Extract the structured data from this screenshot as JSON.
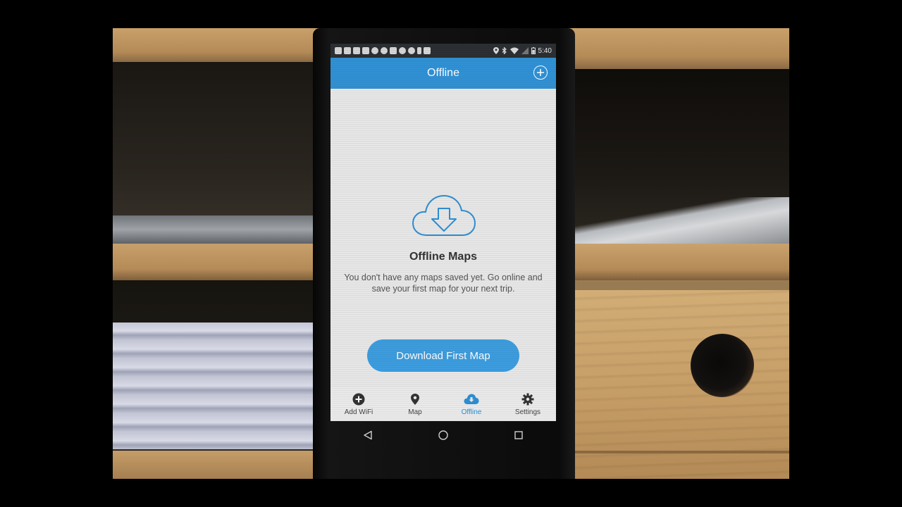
{
  "status_bar": {
    "time": "5:40",
    "icons": [
      "keyboard-icon",
      "facebook-icon",
      "facebook-icon",
      "facebook-icon",
      "globe-icon",
      "globe-icon",
      "facebook-icon",
      "globe-icon",
      "globe-icon",
      "android-icon",
      "mail-icon",
      "location-icon",
      "bluetooth-icon",
      "wifi-icon",
      "no-sim-icon",
      "battery-icon"
    ]
  },
  "app_bar": {
    "title": "Offline"
  },
  "empty_state": {
    "title": "Offline Maps",
    "description": "You don't have any maps saved yet. Go online and save your first map for your next trip."
  },
  "download_button": {
    "label": "Download First Map"
  },
  "bottom_nav": {
    "items": [
      {
        "label": "Add WiFi",
        "icon": "plus-circle-icon",
        "active": false
      },
      {
        "label": "Map",
        "icon": "location-pin-icon",
        "active": false
      },
      {
        "label": "Offline",
        "icon": "cloud-download-icon",
        "active": true
      },
      {
        "label": "Settings",
        "icon": "gear-icon",
        "active": false
      }
    ]
  },
  "colors": {
    "accent": "#3192d6",
    "button": "#3d9ee0",
    "active_tab": "#2f8fd4"
  }
}
